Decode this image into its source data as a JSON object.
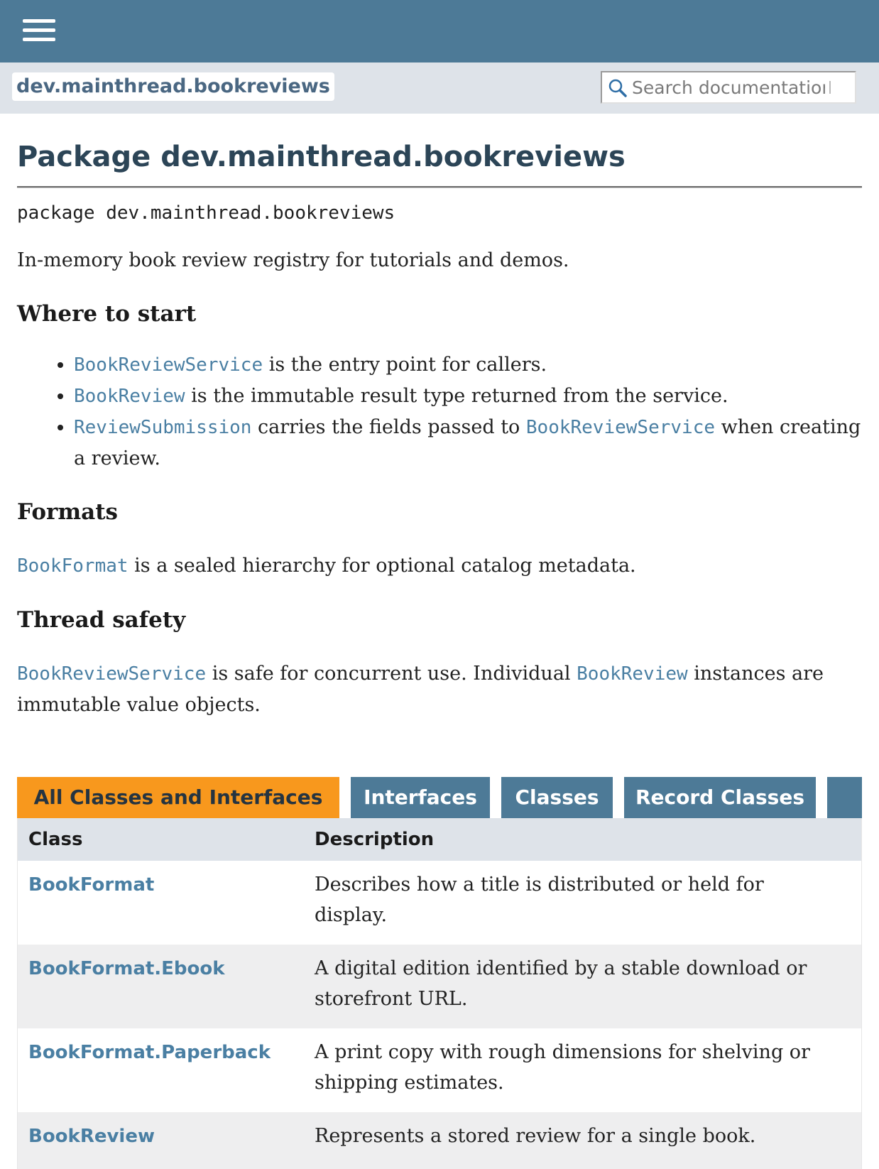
{
  "header": {
    "menu_icon": "hamburger-menu-icon",
    "package_chip": "dev.mainthread.bookreviews",
    "search": {
      "placeholder": "Search documentation",
      "icon": "search-icon"
    }
  },
  "page": {
    "title": "Package dev.mainthread.bookreviews",
    "declaration": "package dev.mainthread.bookreviews",
    "intro": "In-memory book review registry for tutorials and demos."
  },
  "where_to_start": {
    "heading": "Where to start",
    "items": [
      {
        "link": "BookReviewService",
        "text": " is the entry point for callers."
      },
      {
        "link": "BookReview",
        "text": " is the immutable result type returned from the service."
      },
      {
        "link": "ReviewSubmission",
        "text": " carries the fields passed to ",
        "link2": "BookReviewService",
        "text2": " when creating a review."
      }
    ]
  },
  "formats": {
    "heading": "Formats",
    "link": "BookFormat",
    "text": " is a sealed hierarchy for optional catalog metadata."
  },
  "thread_safety": {
    "heading": "Thread safety",
    "link": "BookReviewService",
    "text": " is safe for concurrent use. Individual ",
    "link2": "BookReview",
    "text2": " instances are immutable value objects."
  },
  "tabs": [
    {
      "label": "All Classes and Interfaces",
      "active": true
    },
    {
      "label": "Interfaces",
      "active": false
    },
    {
      "label": "Classes",
      "active": false
    },
    {
      "label": "Record Classes",
      "active": false
    }
  ],
  "table": {
    "headers": {
      "class": "Class",
      "description": "Description"
    },
    "rows": [
      {
        "name": "BookFormat",
        "description": "Describes how a title is distributed or held for display."
      },
      {
        "name": "BookFormat.Ebook",
        "description": "A digital edition identified by a stable download or storefront URL."
      },
      {
        "name": "BookFormat.Paperback",
        "description": "A print copy with rough dimensions for shelving or shipping estimates."
      },
      {
        "name": "BookReview",
        "description": "Represents a stored review for a single book."
      }
    ]
  },
  "colors": {
    "topbar": "#4d7a97",
    "subbar": "#dee3e9",
    "active_tab": "#f8981d",
    "link": "#4a7fa3",
    "title": "#2c4557"
  }
}
